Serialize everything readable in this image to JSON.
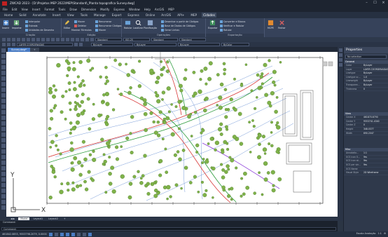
{
  "window": {
    "title": "ZWCAD 2023 - [D:\\Projetos MEP 2022\\MEP\\Standard\\_Planta topografica Survey.dwg]"
  },
  "menubar": [
    "File",
    "Edit",
    "View",
    "Insert",
    "Format",
    "Tools",
    "Draw",
    "Dimension",
    "Modify",
    "Express",
    "Window",
    "Help",
    "ArcGIS",
    "MEP"
  ],
  "ribbon_tabs": [
    {
      "label": "Home",
      "active": false
    },
    {
      "label": "Solid",
      "active": false
    },
    {
      "label": "Annotate",
      "active": false
    },
    {
      "label": "Insert",
      "active": false
    },
    {
      "label": "View",
      "active": false
    },
    {
      "label": "Tools",
      "active": false
    },
    {
      "label": "Manage",
      "active": false
    },
    {
      "label": "Export",
      "active": false
    },
    {
      "label": "Express",
      "active": false
    },
    {
      "label": "Online",
      "active": false
    },
    {
      "label": "ArcGIS",
      "active": false
    },
    {
      "label": "API+",
      "active": false
    },
    {
      "label": "MEP",
      "active": false
    },
    {
      "label": "Cidades",
      "active": true
    }
  ],
  "ribbon": {
    "groups": [
      {
        "label": "Criação"
      },
      {
        "label": "Edição"
      },
      {
        "label": "Operações"
      },
      {
        "label": "Exportação"
      }
    ],
    "buttons": {
      "insert": "Inserir",
      "import": "Importar",
      "interpolar": "Interpolar",
      "estrada": "Estrada",
      "unidades": "Unidades de Desenho",
      "editar": "Editar",
      "mover": "Mover",
      "deletar": "Deletar",
      "mostrar": "Mostrar Fórmulas",
      "mover2": "Mover",
      "renumerar": "Renumerar",
      "renumerar_codigos": "Renumerar Códigos",
      "rotular": "Rotular",
      "localizar": "Localizar",
      "planificacao": "Planificação",
      "desenhar": "Desenhar a partir de Códigos",
      "base_dados": "Base de Dados de Códigos",
      "gerar_linhas": "Gerar Linhas",
      "exportar": "Exportar",
      "converter": "Converter e Blocos",
      "verificar": "Verificar e Rotular",
      "rotular2": "Rotular",
      "mcpe": "MCPE",
      "fechar": "Fechar"
    }
  },
  "toolbar": {
    "layer_combo": "LAYER COORDENADAS",
    "style1": "Standard",
    "style2": "ISO-25",
    "style3": "Standard",
    "style4": "Standard",
    "color_combo": "ByLayer",
    "linetype_combo": "ByLayer",
    "lineweight_combo": "ByLayer",
    "plot_combo": "ByColor"
  },
  "doc_tabs": [
    {
      "label": "Survey.dwg*",
      "active": true
    },
    {
      "label": "+",
      "active": false
    }
  ],
  "layout_tabs": [
    {
      "label": "Model",
      "active": true
    },
    {
      "label": "Layout1",
      "active": false
    },
    {
      "label": "Layout2",
      "active": false
    },
    {
      "label": "+",
      "active": false
    }
  ],
  "command": {
    "history": [
      "Command:",
      "Command:"
    ],
    "prompt": "Command:"
  },
  "status": {
    "coords": "461842.0853, 9553798.2079, 0.0000",
    "right": "Escala Anotação",
    "scale": "1:1"
  },
  "canvas": {
    "axis_x_label": "X",
    "axis_y_label": "Y"
  },
  "properties": {
    "title": "Properties",
    "selection": "No selection",
    "sections": [
      {
        "name": "General",
        "rows": [
          {
            "k": "Color",
            "v": "ByLayer"
          },
          {
            "k": "Layer",
            "v": "LAYER COORDENADAS"
          },
          {
            "k": "Linetype",
            "v": "ByLayer"
          },
          {
            "k": "Linetype sc...",
            "v": "1.0"
          },
          {
            "k": "Lineweight",
            "v": "ByLayer"
          },
          {
            "k": "Transparen...",
            "v": "ByLayer"
          },
          {
            "k": "Thickness",
            "v": "0"
          }
        ]
      },
      {
        "name": "View",
        "rows": [
          {
            "k": "Center X",
            "v": "461870.6790"
          },
          {
            "k": "Center Y",
            "v": "9553741.4340"
          },
          {
            "k": "Center Z",
            "v": "0"
          },
          {
            "k": "Height",
            "v": "348.0377"
          },
          {
            "k": "Width",
            "v": "690.2047"
          }
        ]
      },
      {
        "name": "Misc",
        "rows": [
          {
            "k": "Annotatio...",
            "v": "1:1"
          },
          {
            "k": "UCS icon O...",
            "v": "Yes"
          },
          {
            "k": "UCS icon at...",
            "v": "Yes"
          },
          {
            "k": "UCS per vie...",
            "v": "Yes"
          },
          {
            "k": "UCS Name",
            "v": ""
          },
          {
            "k": "Visual Style",
            "v": "2D Wireframe"
          }
        ]
      }
    ]
  },
  "colors": {
    "window_bg": "#2b3544",
    "accent": "#4a7cc4",
    "canvas_bg": "#ffffff",
    "tree_fill": "#7fb24a",
    "road_red": "#d83a3a",
    "road_green": "#2a9a3a",
    "contour_blue": "#3b6fc7"
  }
}
